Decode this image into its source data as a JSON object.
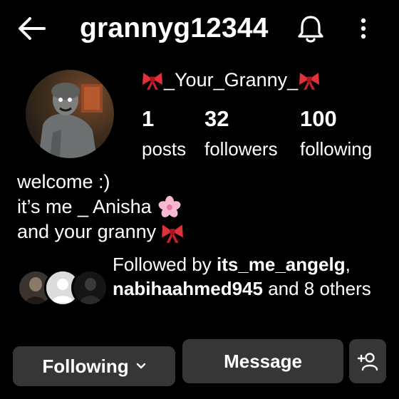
{
  "header": {
    "username": "grannyg12344",
    "back_icon": "arrow-left-icon",
    "notification_icon": "bell-icon",
    "more_icon": "more-vertical-icon"
  },
  "profile": {
    "display_name_text": "_Your_Granny_",
    "display_name_emoji": "ribbon-emoji",
    "stats": [
      {
        "count": "1",
        "label": "posts"
      },
      {
        "count": "32",
        "label": "followers"
      },
      {
        "count": "100",
        "label": "following"
      }
    ],
    "bio": [
      "welcome :)",
      "it’s me _ Anisha",
      "and your granny"
    ],
    "bio_emojis": [
      "cherry-blossom-emoji",
      "ribbon-emoji"
    ]
  },
  "followed_by": {
    "prefix": "Followed by ",
    "user1": "its_me_angelg",
    "separator": ",",
    "user2": "nabihaahmed945",
    "suffix": " and 8 others"
  },
  "actions": {
    "following_label": "Following",
    "message_label": "Message",
    "add_person_icon": "person-add-icon"
  },
  "colors": {
    "background": "#000000",
    "button": "#363636",
    "text": "#ffffff",
    "ribbon": "#e0303a"
  }
}
